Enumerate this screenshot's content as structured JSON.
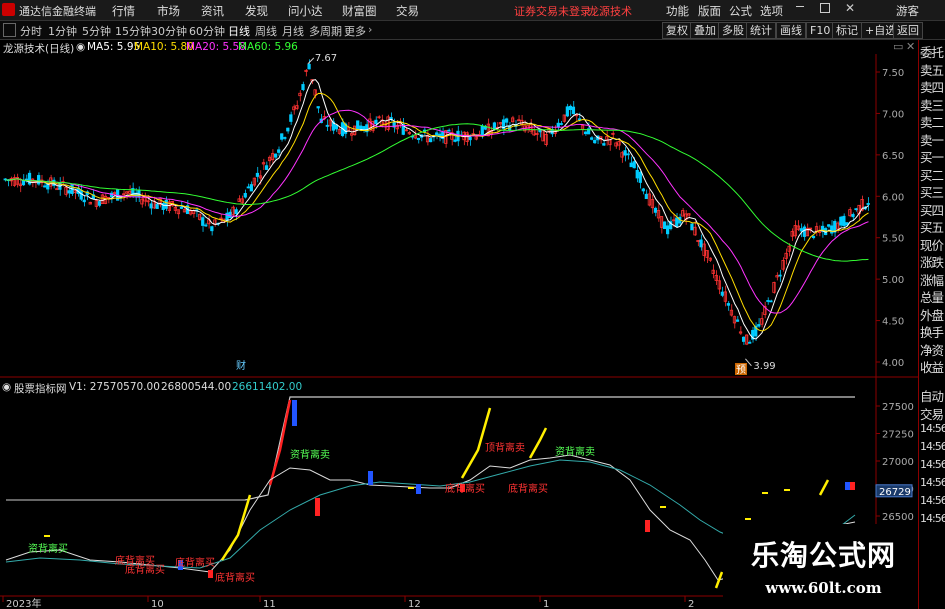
{
  "app": {
    "title": "通达信金融终端",
    "menu": [
      "行情",
      "市场",
      "资讯",
      "发现",
      "问小达",
      "财富圈",
      "交易"
    ],
    "notice": [
      "证券交易未登录",
      "龙源技术"
    ],
    "right_menu": [
      "功能",
      "版面",
      "公式",
      "选项",
      "游客"
    ]
  },
  "toolbar": {
    "periods": [
      "分时",
      "1分钟",
      "5分钟",
      "15分钟",
      "30分钟",
      "60分钟",
      "日线",
      "周线",
      "月线",
      "多周期",
      "更多"
    ],
    "active_period": "日线",
    "right_buttons": [
      "复权",
      "叠加",
      "多股",
      "统计",
      "画线",
      "F10",
      "标记",
      "+自选",
      "返回"
    ]
  },
  "main_chart": {
    "name": "龙源技术(日线)",
    "ma_values": [
      {
        "label": "MA5: 5.95",
        "color": "#ffffff"
      },
      {
        "label": "MA10: 5.80",
        "color": "#ffdd00"
      },
      {
        "label": "MA20: 5.58",
        "color": "#ff33ff"
      },
      {
        "label": "MA60: 5.96",
        "color": "#33ff33"
      }
    ],
    "y_ticks": [
      "7.50",
      "7.00",
      "6.50",
      "6.00",
      "5.50",
      "5.00",
      "4.50",
      "4.00"
    ],
    "high_label": "7.67",
    "low_label": "3.99",
    "markers": [
      "财",
      "预"
    ]
  },
  "sub_chart": {
    "name": "股票指标网",
    "v_values": [
      {
        "label": "V1: 27570570.00",
        "color": "#dddddd"
      },
      {
        "label": "26800544.00",
        "color": "#dddddd"
      },
      {
        "label": "26611402.00",
        "color": "#33cccc"
      }
    ],
    "y_ticks": [
      "27500",
      "27250",
      "27000",
      "26750",
      "26500"
    ],
    "current_value": "26729",
    "labels": [
      "资背离卖",
      "底背离买",
      "底背离买",
      "底背离买",
      "顶背离卖",
      "资背离卖",
      "资背离买",
      "底背离买",
      "底背离买",
      "底背离买"
    ]
  },
  "x_axis": [
    "2023年",
    "10",
    "11",
    "12",
    "1",
    "2"
  ],
  "right_panel": {
    "items": [
      "委托",
      "卖五",
      "卖四",
      "卖三",
      "卖二",
      "卖一",
      "买一",
      "买二",
      "买三",
      "买四",
      "买五",
      "现价",
      "涨跌",
      "涨幅",
      "总量",
      "外盘",
      "换手",
      "净资",
      "收益"
    ],
    "lower_items": [
      "自动",
      "交易",
      "14:56",
      "14:56",
      "14:56",
      "14:56",
      "14:56",
      "14:56"
    ]
  },
  "watermark": {
    "title": "乐淘公式网",
    "url": "www.60lt.com"
  },
  "colors": {
    "up": "#ff3333",
    "down": "#00ccff",
    "ma5": "#ffffff",
    "ma10": "#ffdd00",
    "ma20": "#ff33ff",
    "ma60": "#33ff33",
    "grid": "#8b0000"
  }
}
